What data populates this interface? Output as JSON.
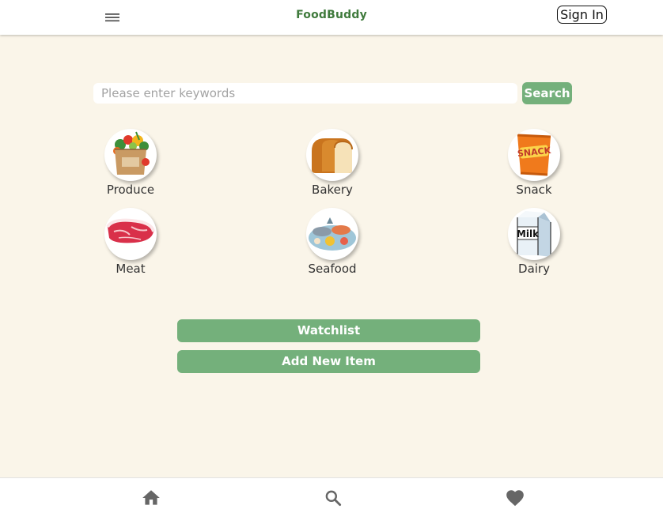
{
  "app": {
    "title": "FoodBuddy",
    "sign_in_label": "Sign In",
    "menu_icon": "hamburger-menu-icon",
    "brand_color": "#3f7a3c",
    "accent_color": "#74b07b",
    "background_color": "#faf5e9"
  },
  "search": {
    "placeholder": "Please enter keywords",
    "value": "",
    "button_label": "Search"
  },
  "categories": [
    {
      "label": "Produce",
      "icon": "produce-bag-icon"
    },
    {
      "label": "Bakery",
      "icon": "bread-icon"
    },
    {
      "label": "Snack",
      "icon": "snack-bag-icon"
    },
    {
      "label": "Meat",
      "icon": "steak-icon"
    },
    {
      "label": "Seafood",
      "icon": "seafood-platter-icon"
    },
    {
      "label": "Dairy",
      "icon": "milk-carton-icon"
    }
  ],
  "snack_bag_text": "SNACK",
  "milk_carton_text": "Milk",
  "actions": {
    "watchlist_label": "Watchlist",
    "add_item_label": "Add New Item"
  },
  "bottom_nav": [
    {
      "icon": "home-icon"
    },
    {
      "icon": "search-icon"
    },
    {
      "icon": "heart-icon"
    }
  ]
}
